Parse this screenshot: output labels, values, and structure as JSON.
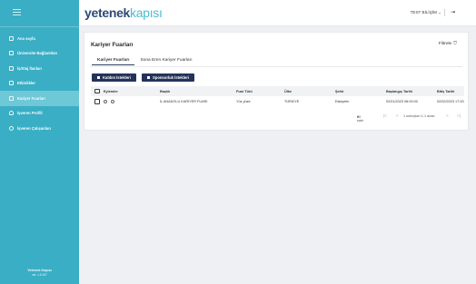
{
  "sidebar": {
    "items": [
      {
        "label": "Ana sayfa",
        "icon": "home-icon"
      },
      {
        "label": "Üniversite Bağlantıları",
        "icon": "building-icon"
      },
      {
        "label": "İş/Staj İlanları",
        "icon": "briefcase-icon"
      },
      {
        "label": "Etkinlikler",
        "icon": "calendar-icon"
      },
      {
        "label": "Kariyer Fuarları",
        "icon": "calendar-icon"
      },
      {
        "label": "İşveren Profili",
        "icon": "user-icon"
      },
      {
        "label": "İşveren Çalışanları",
        "icon": "users-icon"
      }
    ],
    "footer_brand": "Yetenek Kapısı",
    "footer_version": "ver. 1.5.107"
  },
  "topbar": {
    "logo_part1": "yetenek",
    "logo_part2": "kapısı",
    "user_label": "TEST BİLİŞİM ⌄",
    "logout_glyph": "⇥"
  },
  "page": {
    "title": "Kariyer Fuarları",
    "filter_label": "Filtrele",
    "filter_glyph": "⛉",
    "tabs": [
      "Kariyer Fuarları",
      "Sona Eren Kariyer Fuarları"
    ],
    "buttons": [
      "Katılım İstekleri",
      "Sponsorluk İstekleri"
    ]
  },
  "table": {
    "columns": [
      "Eylemler",
      "Başlık",
      "Fuar Türü",
      "Ülke",
      "Şehir",
      "Başlangıç Tarihi",
      "Bitiş Tarihi"
    ],
    "rows": [
      {
        "title": "İL ANADOLU KARİYER FUARI",
        "type": "Yüz yüze",
        "country": "TÜRKİYE",
        "city": "Eskişehir",
        "start": "02/01/2023 08:00:00",
        "end": "02/02/2023 17:00:00"
      }
    ]
  },
  "pager": {
    "per_page": "20 satır",
    "range": "1 sonuçtan 1-1 arası"
  },
  "colors": {
    "sidebar": "#3aaec4",
    "active_item": "#6ec8d7",
    "primary_button": "#24335a",
    "logo_dark": "#2d4a76",
    "logo_light": "#4bbad2"
  }
}
